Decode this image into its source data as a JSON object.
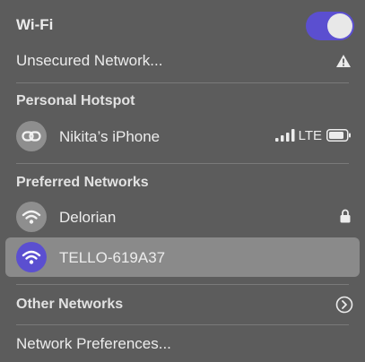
{
  "wifi": {
    "title": "Wi-Fi",
    "enabled": true
  },
  "unsecured": {
    "label": "Unsecured Network...",
    "icon": "warning-icon"
  },
  "hotspot": {
    "section": "Personal Hotspot",
    "name": "Nikita’s iPhone",
    "network_type": "LTE",
    "icon": "link-icon"
  },
  "preferred": {
    "section": "Preferred Networks",
    "items": [
      {
        "name": "Delorian",
        "locked": true,
        "selected": false
      },
      {
        "name": "TELLO-619A37",
        "locked": false,
        "selected": true
      }
    ]
  },
  "other": {
    "label": "Other Networks",
    "icon": "chevron-right-circle-icon"
  },
  "prefs": {
    "label": "Network Preferences..."
  },
  "colors": {
    "accent": "#5b4fd0",
    "background": "#5c5c5c",
    "highlight": "#8a8a8a"
  }
}
